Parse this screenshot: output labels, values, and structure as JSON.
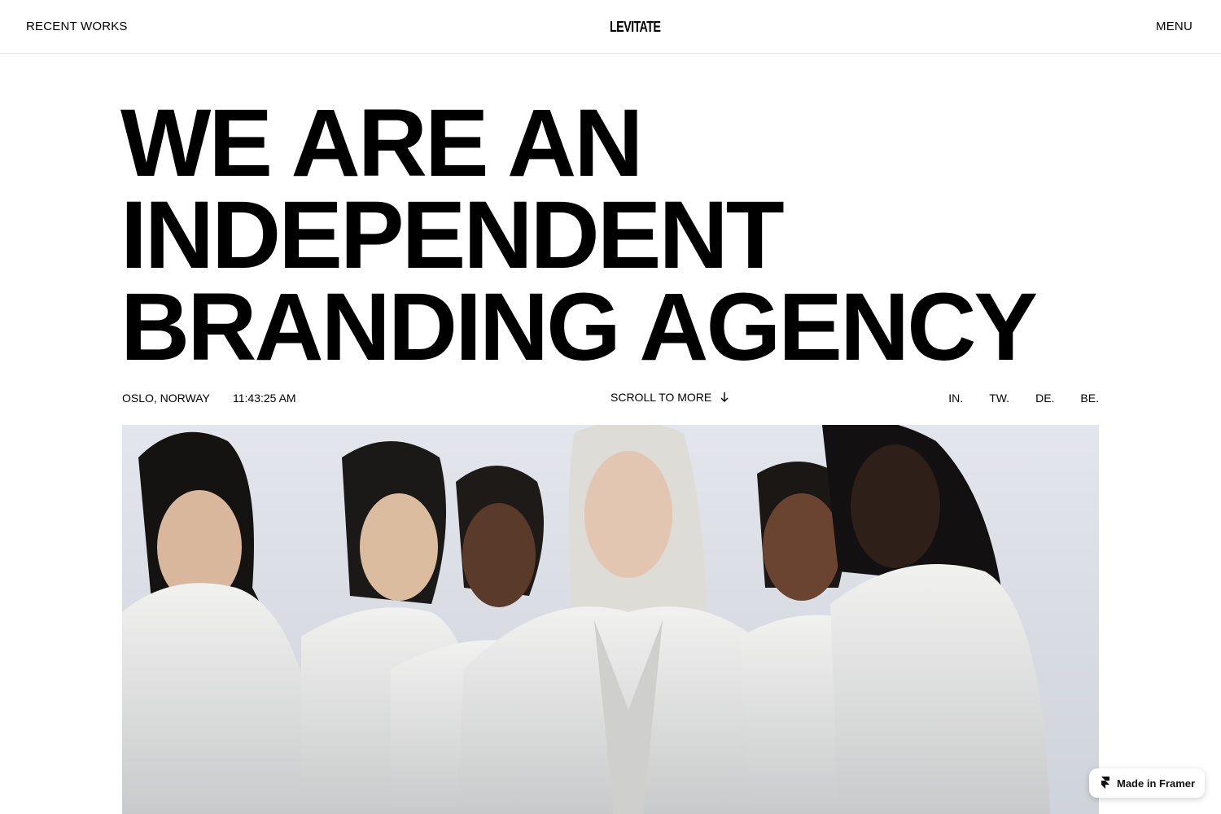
{
  "header": {
    "left_link": "RECENT WORKS",
    "logo": "LEVITATE",
    "right_link": "MENU"
  },
  "hero": {
    "headline_lines": [
      "WE ARE AN",
      "INDEPENDENT",
      "BRANDING AGENCY"
    ],
    "image_icon": "editorial-photo"
  },
  "meta": {
    "location": "OSLO, NORWAY",
    "time": "11:43:25 AM",
    "scroll_label": "SCROLL TO MORE",
    "scroll_icon": "arrow-down-icon",
    "socials": [
      "IN.",
      "TW.",
      "DE.",
      "BE."
    ]
  },
  "badge": {
    "label": "Made in Framer",
    "icon": "framer-icon"
  },
  "colors": {
    "background": "#ffffff",
    "text": "#000000",
    "divider": "#e6e6e6"
  }
}
